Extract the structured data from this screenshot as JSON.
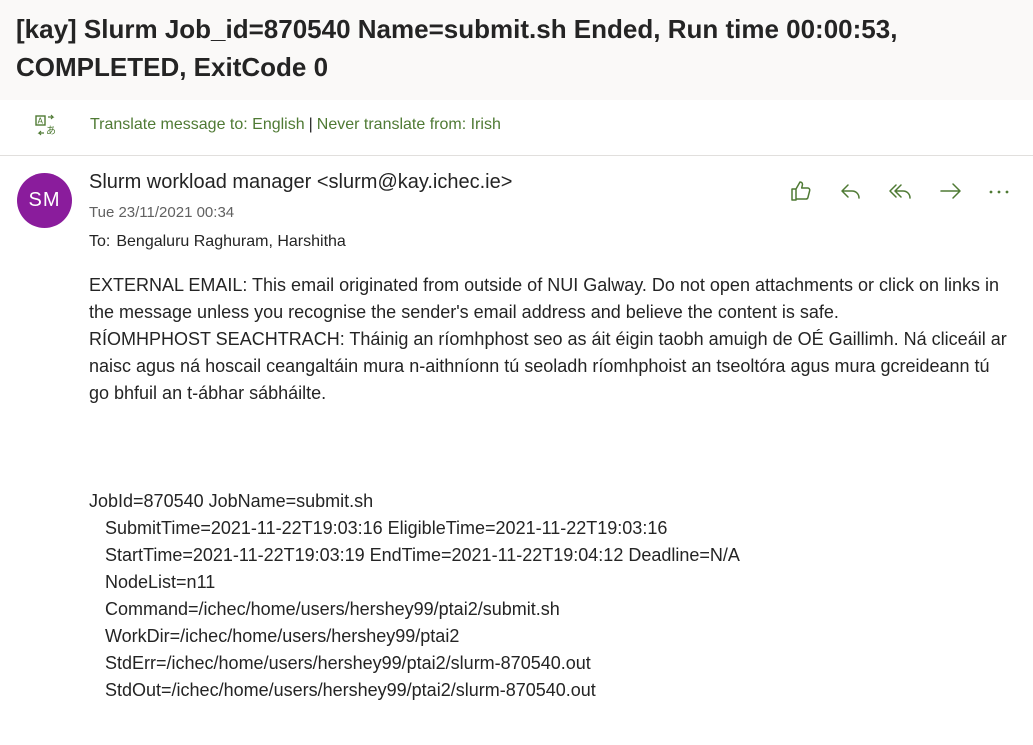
{
  "subject": "[kay] Slurm Job_id=870540 Name=submit.sh Ended, Run time 00:00:53, COMPLETED, ExitCode 0",
  "translate": {
    "translate_link": "Translate message to: English",
    "separator": "|",
    "never_link": "Never translate from: Irish"
  },
  "message": {
    "avatar_initials": "SM",
    "avatar_color": "#8a1c9c",
    "sender": "Slurm workload manager <slurm@kay.ichec.ie>",
    "date": "Tue 23/11/2021 00:34",
    "to_label": "To:",
    "to_value": "Bengaluru Raghuram, Harshitha"
  },
  "actions": [
    "like-icon",
    "reply-icon",
    "reply-all-icon",
    "forward-icon",
    "more-icon"
  ],
  "body": {
    "external_en": "EXTERNAL EMAIL: This email originated from outside of NUI Galway. Do not open attachments or click on links in the message unless you recognise the sender's email address and believe the content is safe.",
    "external_ga": "RÍOMHPHOST SEACHTRACH: Tháinig an ríomhphost seo as áit éigin taobh amuigh de OÉ Gaillimh. Ná cliceáil ar naisc agus ná hoscail ceangaltáin mura n-aithníonn tú seoladh ríomhphoist an tseoltóra agus mura gcreideann tú go bhfuil an t-ábhar sábháilte."
  },
  "job": {
    "line1": "JobId=870540 JobName=submit.sh",
    "line2": "SubmitTime=2021-11-22T19:03:16 EligibleTime=2021-11-22T19:03:16",
    "line3": "StartTime=2021-11-22T19:03:19 EndTime=2021-11-22T19:04:12 Deadline=N/A",
    "line4": "NodeList=n11",
    "line5": "Command=/ichec/home/users/hershey99/ptai2/submit.sh",
    "line6": "WorkDir=/ichec/home/users/hershey99/ptai2",
    "line7": "StdErr=/ichec/home/users/hershey99/ptai2/slurm-870540.out",
    "line8": "StdOut=/ichec/home/users/hershey99/ptai2/slurm-870540.out"
  },
  "colors": {
    "accent_green": "#4f7a34",
    "subject_bg": "#faf9f8"
  }
}
